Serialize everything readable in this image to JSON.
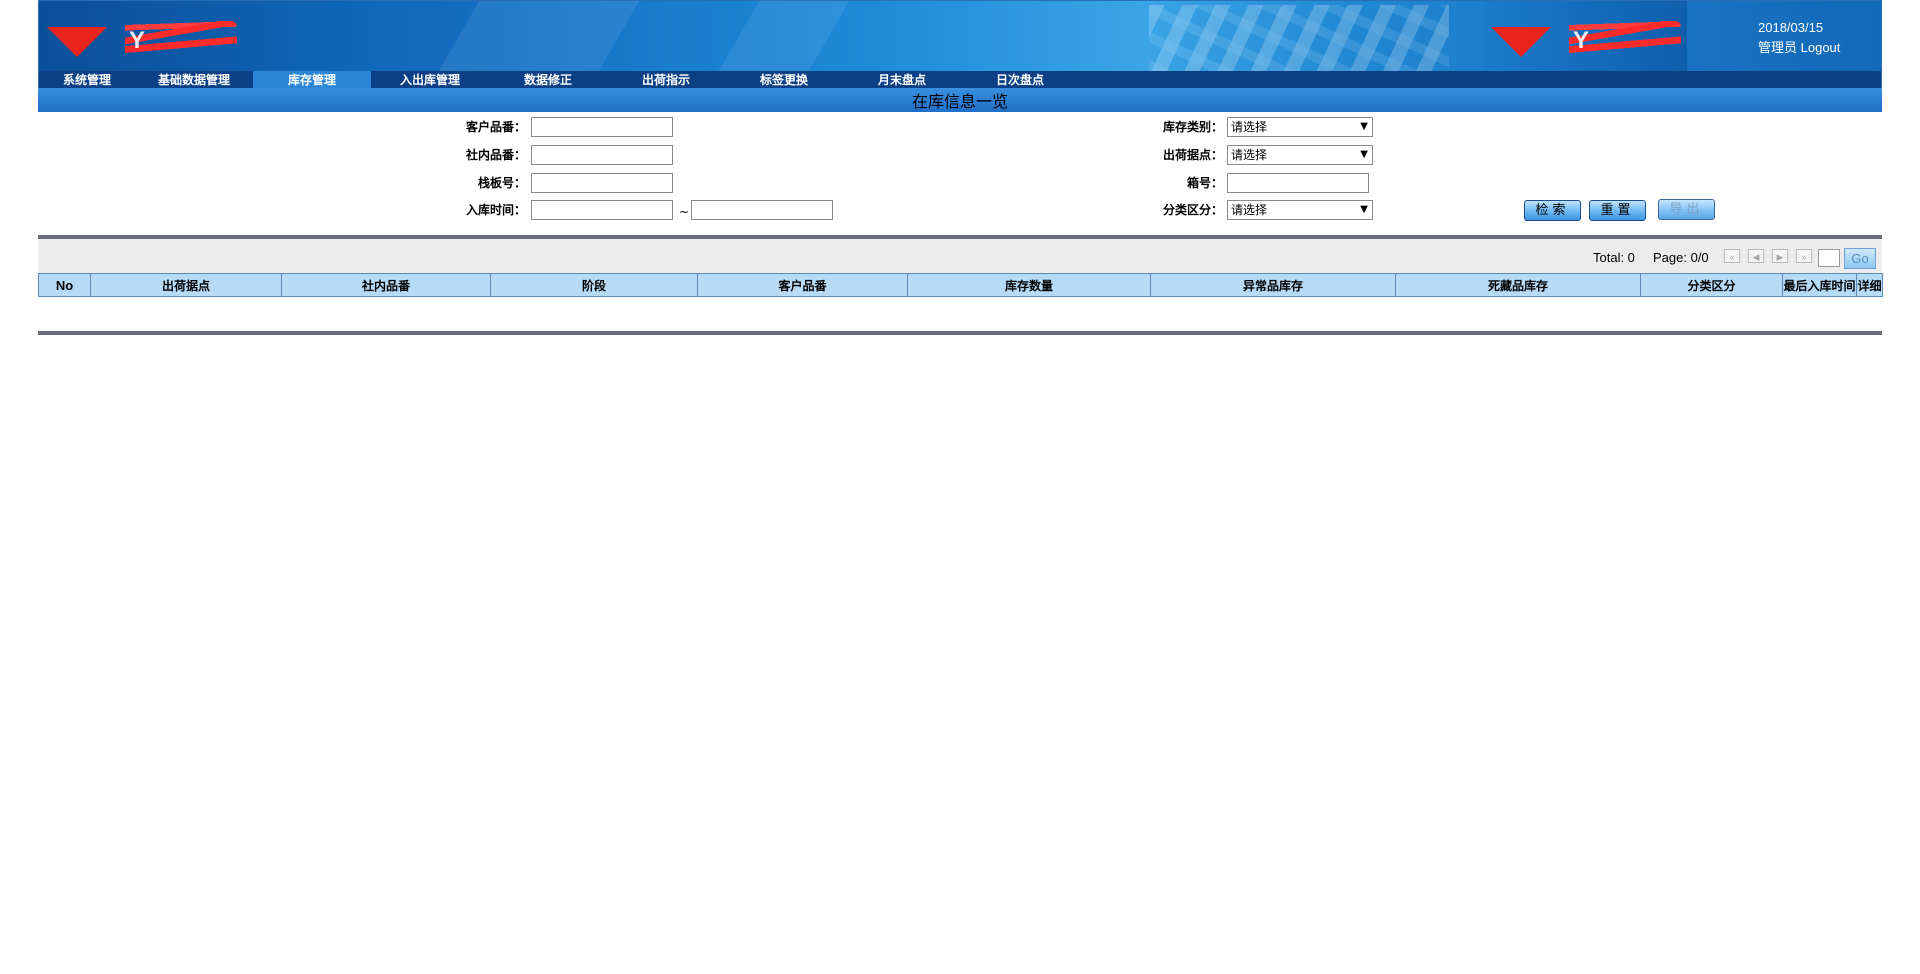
{
  "header": {
    "logo_text": "Y",
    "logo_text_right": "Y",
    "date": "2018/03/15",
    "user": "管理员",
    "logout": "Logout"
  },
  "nav": {
    "items": [
      "系统管理",
      "基础数据管理",
      "库存管理",
      "入出库管理",
      "数据修正",
      "出荷指示",
      "标签更换",
      "月末盘点",
      "日次盘点"
    ],
    "active": "库存管理"
  },
  "page_title": "在库信息一览",
  "form": {
    "customer_part_label": "客户品番：",
    "internal_part_label": "社内品番：",
    "pallet_label": "栈板号：",
    "inbound_time_label": "入库时间：",
    "tilde": "~",
    "stock_type_label": "库存类别：",
    "shipping_point_label": "出荷据点：",
    "box_no_label": "箱号：",
    "category_label": "分类区分：",
    "select_placeholder": "请选择",
    "search_button": "检索",
    "reset_button": "重置",
    "export_button": "导出"
  },
  "pager": {
    "total": "Total: 0",
    "page": "Page: 0/0",
    "go": "Go"
  },
  "table": {
    "headers": [
      "No",
      "出荷据点",
      "社内品番",
      "阶段",
      "客户品番",
      "库存数量",
      "异常品库存",
      "死藏品库存",
      "分类区分",
      "最后入库时间",
      "详细"
    ]
  }
}
